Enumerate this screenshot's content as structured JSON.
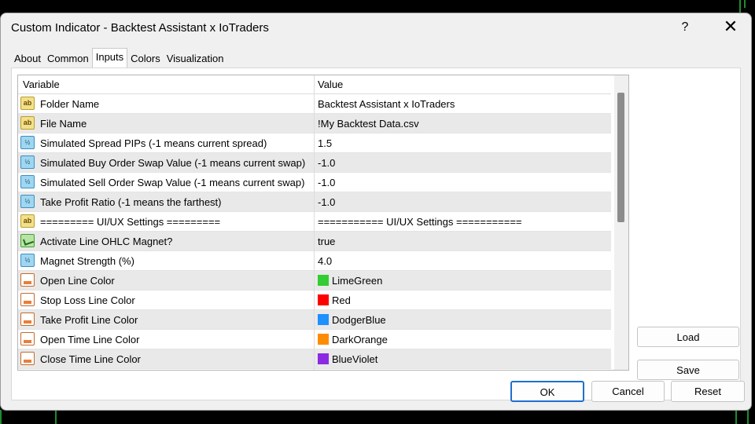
{
  "window": {
    "title": "Custom Indicator - Backtest Assistant x IoTraders",
    "help_label": "?",
    "close_label": "✕"
  },
  "tabs": [
    "About",
    "Common",
    "Inputs",
    "Colors",
    "Visualization"
  ],
  "active_tab": "Inputs",
  "grid": {
    "headers": {
      "variable": "Variable",
      "value": "Value"
    },
    "rows": [
      {
        "icon": "ab",
        "type": "text",
        "name": "Folder Name",
        "value": "Backtest Assistant x IoTraders"
      },
      {
        "icon": "ab",
        "type": "text",
        "name": "File Name",
        "value": "!My Backtest Data.csv"
      },
      {
        "icon": "½",
        "type": "num",
        "name": "Simulated Spread PIPs (-1 means current spread)",
        "value": "1.5"
      },
      {
        "icon": "½",
        "type": "num",
        "name": "Simulated Buy Order Swap Value (-1 means current swap)",
        "value": "-1.0"
      },
      {
        "icon": "½",
        "type": "num",
        "name": "Simulated Sell Order Swap Value (-1 means current swap)",
        "value": "-1.0"
      },
      {
        "icon": "½",
        "type": "num",
        "name": "Take Profit Ratio (-1 means the farthest)",
        "value": "-1.0"
      },
      {
        "icon": "ab",
        "type": "text",
        "name": "========= UI/UX Settings =========",
        "value": "=========== UI/UX Settings ==========="
      },
      {
        "icon": "",
        "type": "bool",
        "name": "Activate Line OHLC Magnet?",
        "value": "true"
      },
      {
        "icon": "½",
        "type": "num",
        "name": "Magnet Strength (%)",
        "value": "4.0"
      },
      {
        "icon": "",
        "type": "color",
        "name": "Open Line Color",
        "value": "LimeGreen",
        "swatch": "#32cd32"
      },
      {
        "icon": "",
        "type": "color",
        "name": "Stop Loss Line Color",
        "value": "Red",
        "swatch": "#ff0000"
      },
      {
        "icon": "",
        "type": "color",
        "name": "Take Profit Line Color",
        "value": "DodgerBlue",
        "swatch": "#1e90ff"
      },
      {
        "icon": "",
        "type": "color",
        "name": "Open Time Line Color",
        "value": "DarkOrange",
        "swatch": "#ff8c00"
      },
      {
        "icon": "",
        "type": "color",
        "name": "Close Time Line Color",
        "value": "BlueViolet",
        "swatch": "#8a2be2"
      }
    ]
  },
  "side_buttons": {
    "load": "Load",
    "save": "Save"
  },
  "buttons": {
    "ok": "OK",
    "cancel": "Cancel",
    "reset": "Reset"
  },
  "colors": {
    "accent": "#1f6fcf",
    "background_line": "#1e8c2e"
  }
}
